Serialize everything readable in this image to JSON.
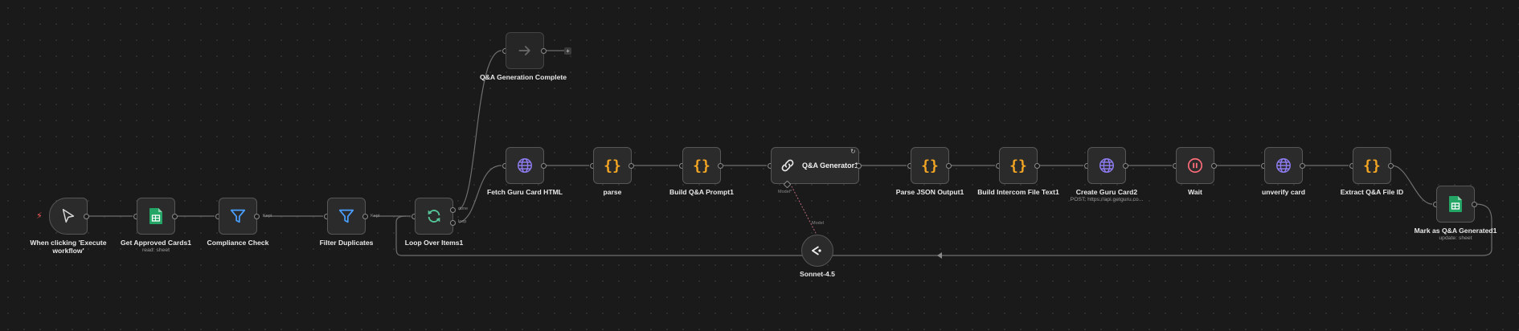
{
  "canvas": {
    "background": "#1a1a1a",
    "wire_color": "#6e6e6e"
  },
  "colors": {
    "sheets": "#23a566",
    "filter": "#4a9fff",
    "loop": "#56c79b",
    "http": "#8c7cf0",
    "code": "#f5a623",
    "wait": "#ff6d7a",
    "trigger_bolt": "#ff5a5a"
  },
  "nodes": {
    "trigger": {
      "label": "When clicking 'Execute workflow'",
      "icon": "cursor-icon"
    },
    "get_cards": {
      "label": "Get Approved Cards1",
      "sub": "read: sheet",
      "icon": "google-sheets-icon"
    },
    "compliance": {
      "label": "Compliance Check",
      "icon": "filter-icon",
      "port": "Kept"
    },
    "dedupe": {
      "label": "Filter Duplicates",
      "icon": "filter-icon",
      "port": "Kept"
    },
    "loop": {
      "label": "Loop Over Items1",
      "icon": "loop-icon",
      "port_done": "done",
      "port_loop": "loop"
    },
    "complete": {
      "label": "Q&A Generation Complete",
      "icon": "arrow-right-icon"
    },
    "fetch": {
      "label": "Fetch Guru Card HTML",
      "icon": "globe-icon"
    },
    "parse": {
      "label": "parse",
      "icon": "code-braces-icon"
    },
    "build_prompt": {
      "label": "Build Q&A Prompt1",
      "icon": "code-braces-icon"
    },
    "generator": {
      "label": "Q&A Generator1",
      "icon": "link-chain-icon",
      "port_model": "Model*"
    },
    "model": {
      "label": "Sonnet-4.5",
      "icon": "anthropic-icon",
      "port": "Model"
    },
    "parse_json": {
      "label": "Parse JSON Output1",
      "icon": "code-braces-icon"
    },
    "intercom": {
      "label": "Build Intercom File Text1",
      "icon": "code-braces-icon"
    },
    "create_card": {
      "label": "Create Guru Card2",
      "sub": "POST: https://api.getguru.co...",
      "icon": "globe-icon"
    },
    "wait": {
      "label": "Wait",
      "icon": "pause-icon"
    },
    "unverify": {
      "label": "unverify card",
      "icon": "globe-icon"
    },
    "extract": {
      "label": "Extract Q&A File ID",
      "icon": "code-braces-icon"
    },
    "mark": {
      "label": "Mark as Q&A Generated1",
      "sub": "update: sheet",
      "icon": "google-sheets-icon"
    }
  }
}
